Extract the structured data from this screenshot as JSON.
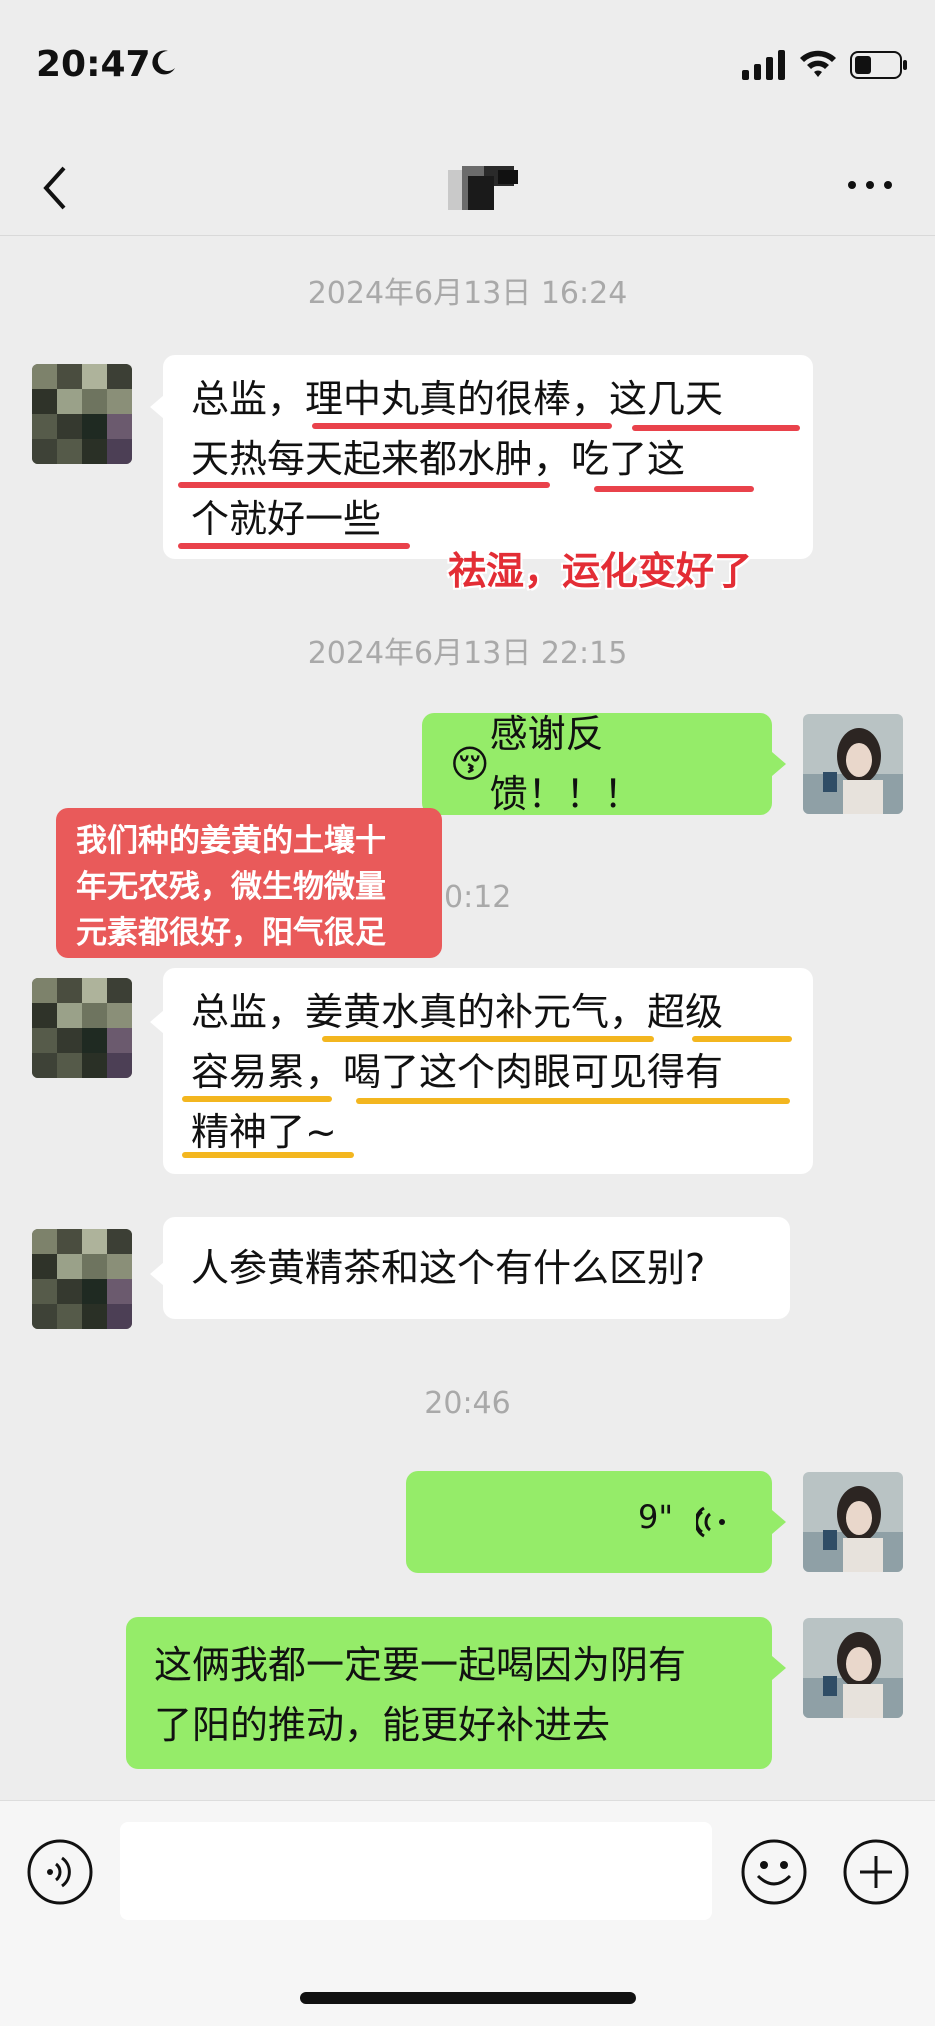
{
  "status": {
    "time": "20:47"
  },
  "nav": {
    "title": ""
  },
  "messages": {
    "ts1": "2024年6月13日 16:24",
    "m1_l1": "总监，理中丸真的很棒，这几天",
    "m1_l2": "天热每天起来都水肿，吃了这",
    "m1_l3": "个就好一些",
    "annotation1": "祛湿，运化变好了",
    "ts2": "2024年6月13日 22:15",
    "reply1": "感谢反馈！！！",
    "reply1_emoji": "😚",
    "annotation2_l1": "我们种的姜黄的土壤十",
    "annotation2_l2": "年无农残，微生物微量",
    "annotation2_l3": "元素都很好，阳气很足",
    "ts3_visible": "0:12",
    "m2_l1": "总监，姜黄水真的补元气，超级",
    "m2_l2": "容易累，喝了这个肉眼可见得有",
    "m2_l3": "精神了~",
    "m3": "人参黄精茶和这个有什么区别?",
    "ts4": "20:46",
    "voice_duration": "9\"",
    "reply2_l1": "这俩我都一定要一起喝因为阴有",
    "reply2_l2": "了阳的推动，能更好补进去"
  },
  "icons": {
    "voice_toggle": "voice-icon",
    "emoji": "emoji-icon",
    "plus": "plus-icon"
  }
}
